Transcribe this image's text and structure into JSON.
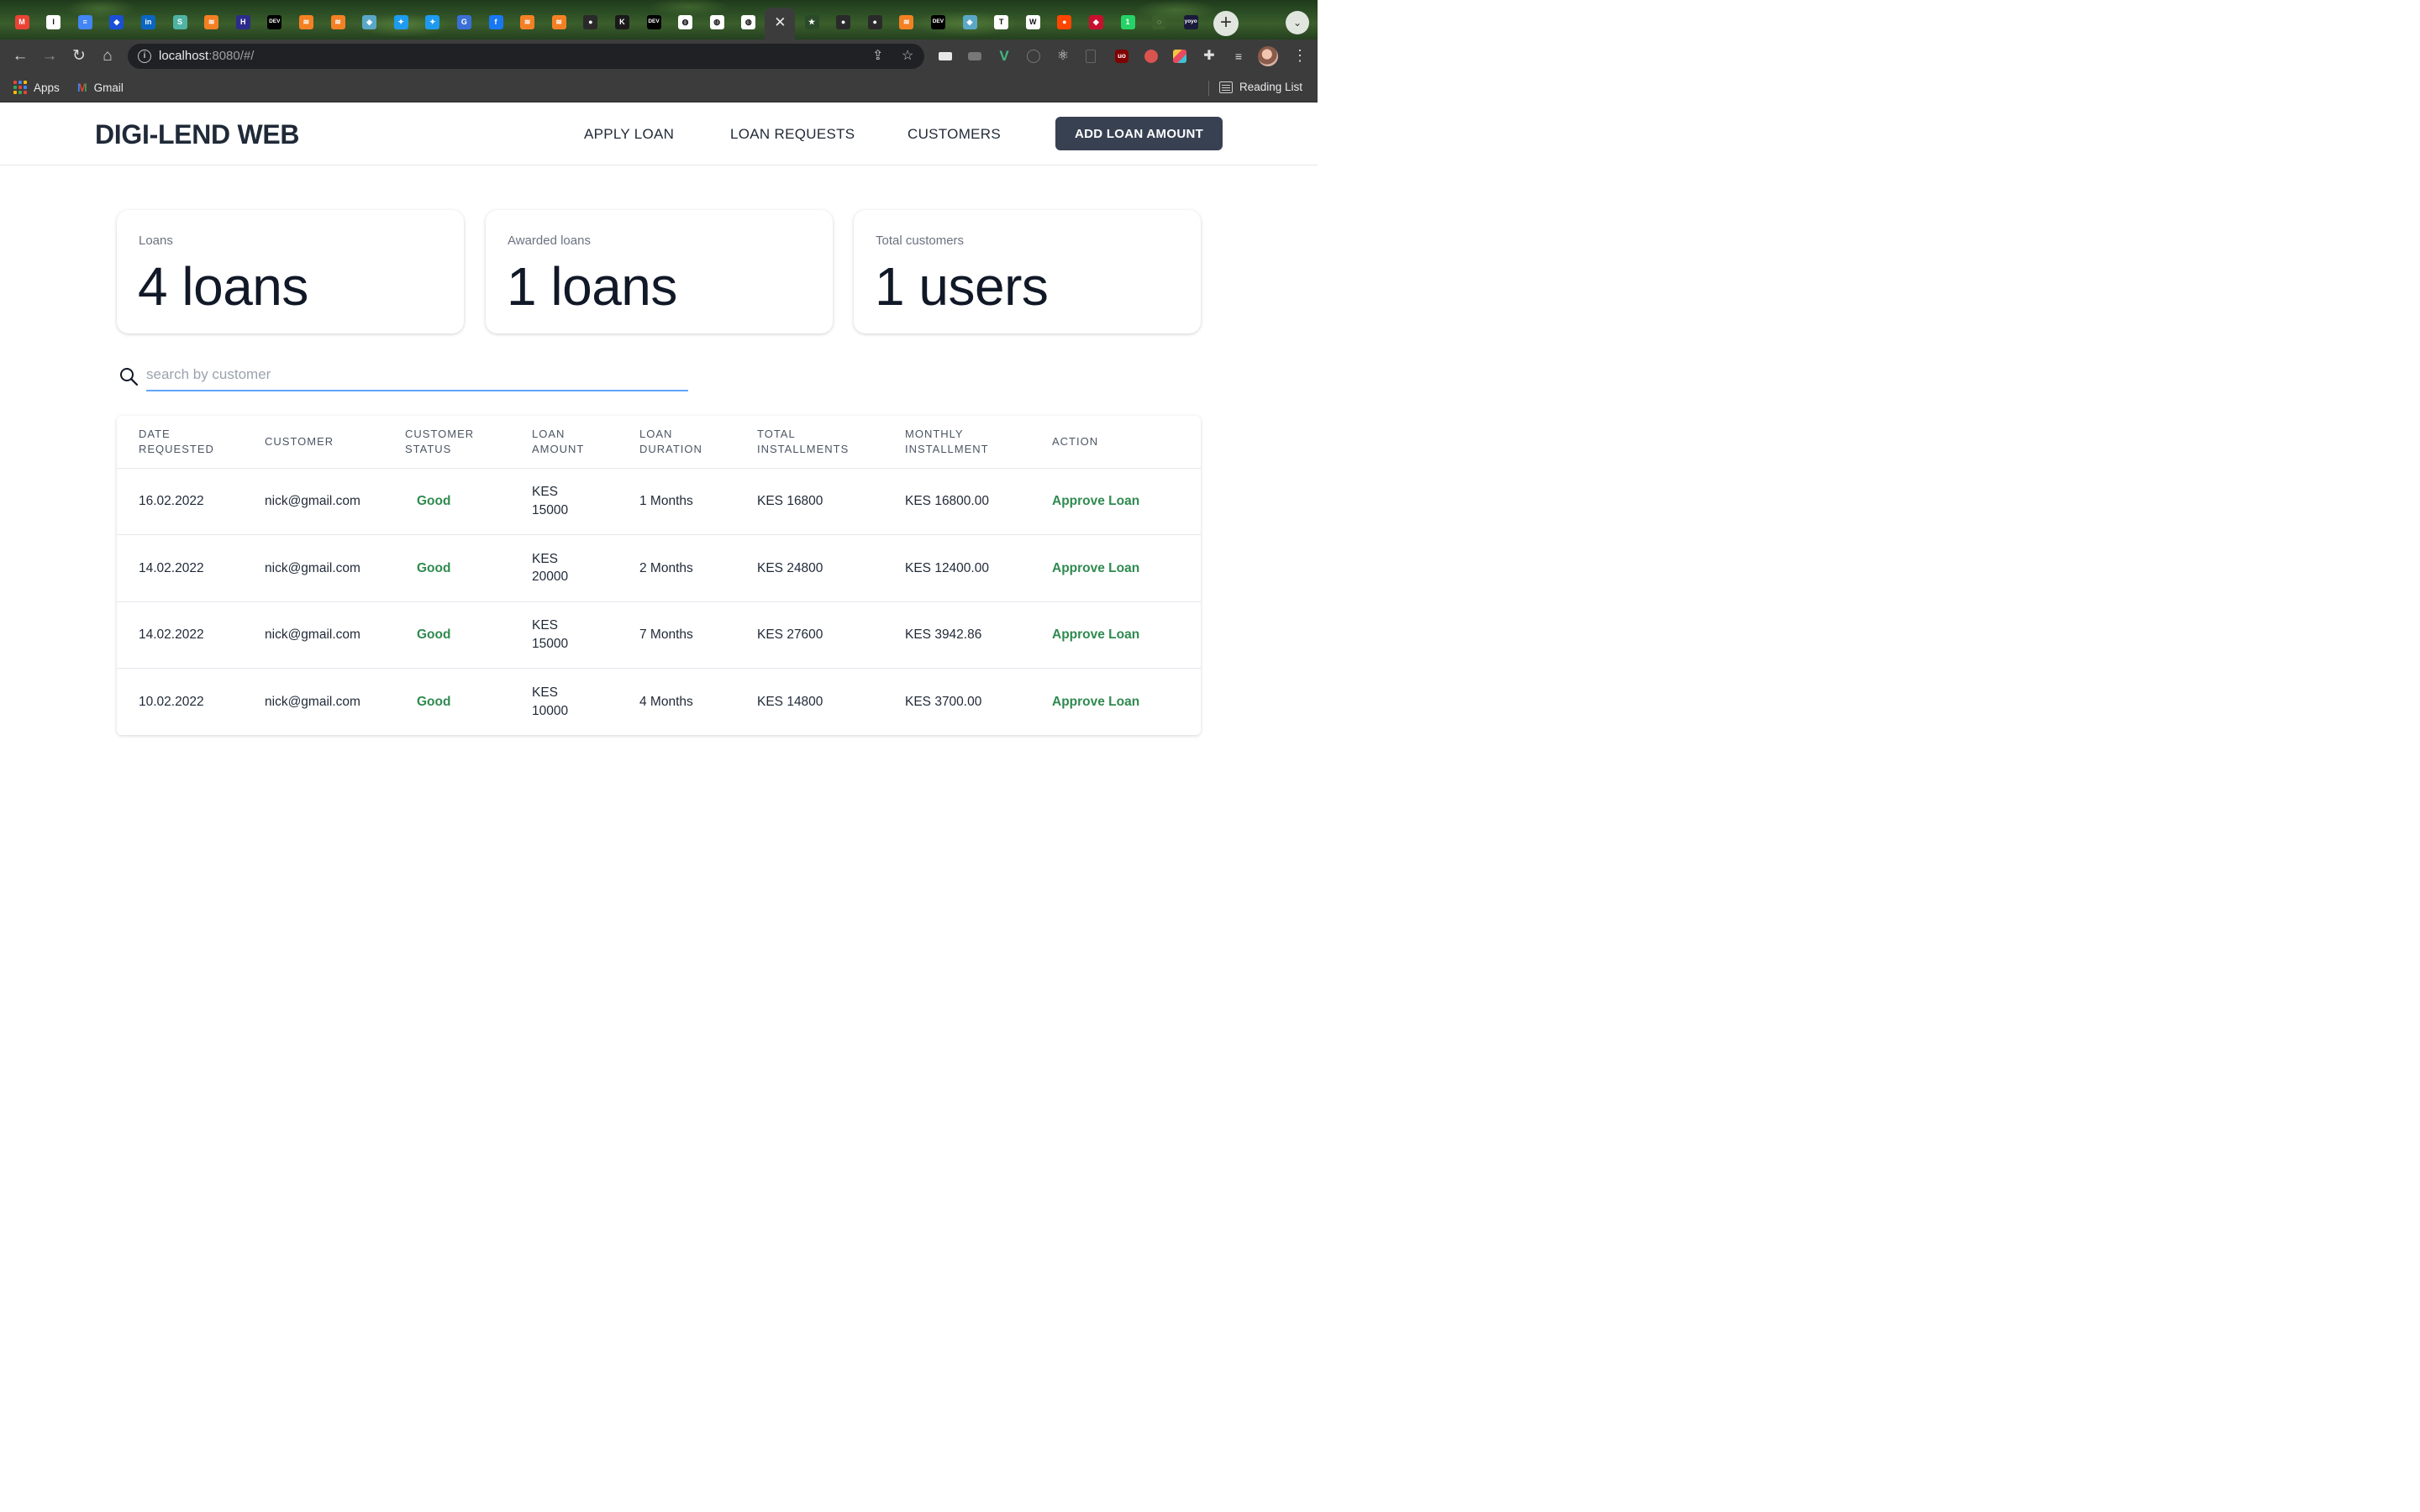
{
  "browser": {
    "url_host": "localhost",
    "url_rest": ":8080/#/",
    "bookmarks": [
      {
        "label": "Apps"
      },
      {
        "label": "Gmail"
      }
    ],
    "reading_list_label": "Reading List",
    "tabs": [
      {
        "icon": "gmail-icon",
        "color": "#ea4335",
        "glyph": "M"
      },
      {
        "icon": "instapaper-icon",
        "color": "#ffffff",
        "glyph": "I"
      },
      {
        "icon": "google-docs-icon",
        "color": "#4285f4",
        "glyph": "≡"
      },
      {
        "icon": "bookmark-app-icon",
        "color": "#1a4fd6",
        "glyph": "◆"
      },
      {
        "icon": "linkedin-icon",
        "color": "#0a66c2",
        "glyph": "in"
      },
      {
        "icon": "sheets-app-icon",
        "color": "#4fb3a4",
        "glyph": "S"
      },
      {
        "icon": "stackoverflow-icon",
        "color": "#f48024",
        "glyph": "≋"
      },
      {
        "icon": "indeed-icon",
        "color": "#2c2c8c",
        "glyph": "H"
      },
      {
        "icon": "dev-to-icon",
        "color": "#000000",
        "glyph": "DEV"
      },
      {
        "icon": "stackoverflow-icon",
        "color": "#f48024",
        "glyph": "≋"
      },
      {
        "icon": "stackoverflow-icon",
        "color": "#f48024",
        "glyph": "≋"
      },
      {
        "icon": "cube-icon",
        "color": "#5aa8c8",
        "glyph": "◈"
      },
      {
        "icon": "twitter-icon",
        "color": "#1d9bf0",
        "glyph": "✦"
      },
      {
        "icon": "twitter-icon",
        "color": "#1d9bf0",
        "glyph": "✦"
      },
      {
        "icon": "grammarly-icon",
        "color": "#3b6fd8",
        "glyph": "G"
      },
      {
        "icon": "facebook-icon",
        "color": "#1877f2",
        "glyph": "f"
      },
      {
        "icon": "stackoverflow-icon",
        "color": "#f48024",
        "glyph": "≋"
      },
      {
        "icon": "stackoverflow-icon",
        "color": "#f48024",
        "glyph": "≋"
      },
      {
        "icon": "github-icon",
        "color": "#2a2a2a",
        "glyph": "●"
      },
      {
        "icon": "kaggle-icon",
        "color": "#1a1a1a",
        "glyph": "K"
      },
      {
        "icon": "dev-to-icon",
        "color": "#000000",
        "glyph": "DEV"
      },
      {
        "icon": "globe-icon",
        "color": "#ffffff",
        "glyph": "◍"
      },
      {
        "icon": "globe-icon",
        "color": "#ffffff",
        "glyph": "◍"
      },
      {
        "icon": "globe-icon",
        "color": "#ffffff",
        "glyph": "◍"
      },
      {
        "icon": "close-icon",
        "color": "#3c3c3c",
        "glyph": "✕",
        "active": true
      },
      {
        "icon": "star-app-icon",
        "color": "#2a4a2a",
        "glyph": "★"
      },
      {
        "icon": "github-icon",
        "color": "#2a2a2a",
        "glyph": "●"
      },
      {
        "icon": "github-icon",
        "color": "#2a2a2a",
        "glyph": "●"
      },
      {
        "icon": "stackoverflow-icon",
        "color": "#f48024",
        "glyph": "≋"
      },
      {
        "icon": "dev-to-icon",
        "color": "#000000",
        "glyph": "DEV"
      },
      {
        "icon": "cube-icon",
        "color": "#5aa8c8",
        "glyph": "◈"
      },
      {
        "icon": "instapaper-icon",
        "color": "#ffffff",
        "glyph": "T"
      },
      {
        "icon": "wtm-icon",
        "color": "#ffffff",
        "glyph": "W"
      },
      {
        "icon": "reddit-icon",
        "color": "#ff4500",
        "glyph": "●"
      },
      {
        "icon": "tag-icon",
        "color": "#c8102e",
        "glyph": "◆"
      },
      {
        "icon": "whatsapp-icon",
        "color": "#25d366",
        "glyph": "1"
      },
      {
        "icon": "loading-icon",
        "color": "#3b5e2c",
        "glyph": "◌"
      },
      {
        "icon": "yoyo-icon",
        "color": "#1a1a3a",
        "glyph": "yoyo"
      }
    ]
  },
  "app": {
    "brand": "DIGI-LEND WEB",
    "nav": {
      "apply_loan": "APPLY LOAN",
      "loan_requests": "LOAN REQUESTS",
      "customers": "CUSTOMERS",
      "add_loan_amount": "ADD LOAN AMOUNT"
    },
    "stats": [
      {
        "label": "Loans",
        "value": "4 loans"
      },
      {
        "label": "Awarded loans",
        "value": "1 loans"
      },
      {
        "label": "Total customers",
        "value": "1 users"
      }
    ],
    "search": {
      "placeholder": "search by customer",
      "value": ""
    },
    "table": {
      "headers": [
        [
          "DATE",
          "REQUESTED"
        ],
        [
          "CUSTOMER"
        ],
        [
          "CUSTOMER",
          "STATUS"
        ],
        [
          "LOAN",
          "AMOUNT"
        ],
        [
          "LOAN",
          "DURATION"
        ],
        [
          "TOTAL",
          "INSTALLMENTS"
        ],
        [
          "MONTHLY",
          "INSTALLMENT"
        ],
        [
          "ACTION"
        ]
      ],
      "rows": [
        {
          "date": "16.02.2022",
          "customer": "nick@gmail.com",
          "status": "Good",
          "amount_currency": "KES",
          "amount_value": "15000",
          "duration": "1 Months",
          "total": "KES 16800",
          "monthly": "KES 16800.00",
          "action": "Approve Loan"
        },
        {
          "date": "14.02.2022",
          "customer": "nick@gmail.com",
          "status": "Good",
          "amount_currency": "KES",
          "amount_value": "20000",
          "duration": "2 Months",
          "total": "KES 24800",
          "monthly": "KES 12400.00",
          "action": "Approve Loan"
        },
        {
          "date": "14.02.2022",
          "customer": "nick@gmail.com",
          "status": "Good",
          "amount_currency": "KES",
          "amount_value": "15000",
          "duration": "7 Months",
          "total": "KES 27600",
          "monthly": "KES 3942.86",
          "action": "Approve Loan"
        },
        {
          "date": "10.02.2022",
          "customer": "nick@gmail.com",
          "status": "Good",
          "amount_currency": "KES",
          "amount_value": "10000",
          "duration": "4 Months",
          "total": "KES 14800",
          "monthly": "KES 3700.00",
          "action": "Approve Loan"
        }
      ]
    }
  },
  "colors": {
    "status_good": "#2f8a4f",
    "action_link": "#2f8a4f",
    "primary_button": "#374151",
    "search_underline": "#60a5fa"
  }
}
